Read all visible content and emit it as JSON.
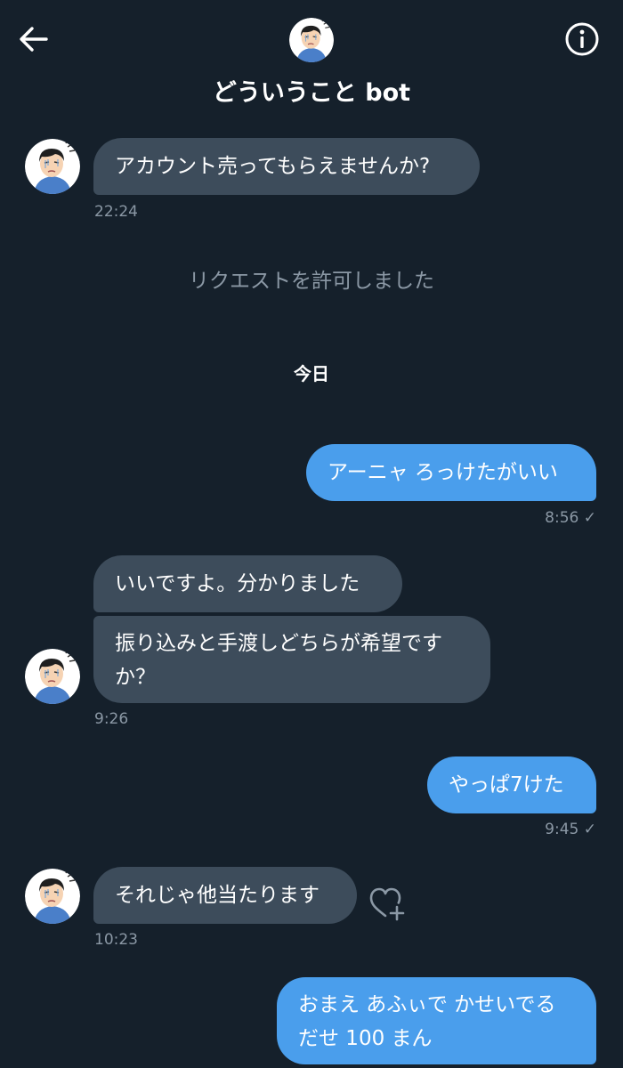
{
  "header": {
    "title": "どういうこと bot",
    "back_icon": "arrow-left-icon",
    "info_icon": "info-circle-icon"
  },
  "messages": {
    "m1": {
      "text": "アカウント売ってもらえませんか?",
      "time": "22:24"
    },
    "system": "リクエストを許可しました",
    "date_separator": "今日",
    "m2": {
      "text": "アーニャ ろっけたがいい",
      "time": "8:56 ✓"
    },
    "m3": {
      "text": "いいですよ。分かりました"
    },
    "m4": {
      "line1": "振り込みと手渡しどちらが希望です",
      "line2": "か？",
      "time": "9:26"
    },
    "m5": {
      "text": "やっぱ7けた",
      "time": "9:45 ✓"
    },
    "m6": {
      "text": "それじゃ他当たります",
      "time": "10:23"
    },
    "m7": {
      "line1": "おまえ あふぃで かせいでる",
      "line2": "だせ 100 まん"
    }
  },
  "colors": {
    "background": "#15202b",
    "incoming_bubble": "#3d4c5b",
    "outgoing_bubble": "#4a9eec",
    "secondary_text": "#8b98a5"
  }
}
